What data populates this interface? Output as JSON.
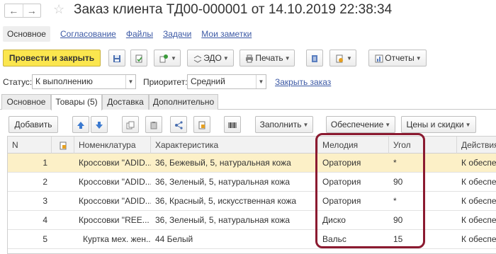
{
  "title": "Заказ клиента ТД00-000001 от 14.10.2019 22:38:34",
  "subnav": [
    "Основное",
    "Согласование",
    "Файлы",
    "Задачи",
    "Мои заметки"
  ],
  "toolbar": {
    "post_close": "Провести и закрыть",
    "edo": "ЭДО",
    "print": "Печать",
    "reports": "Отчеты"
  },
  "status": {
    "label": "Статус:",
    "value": "К выполнению",
    "priority_label": "Приоритет:",
    "priority_value": "Средний",
    "close_link": "Закрыть заказ"
  },
  "tabs": [
    "Основное",
    "Товары (5)",
    "Доставка",
    "Дополнительно"
  ],
  "table_toolbar": {
    "add": "Добавить",
    "fill": "Заполнить",
    "provision": "Обеспечение",
    "prices": "Цены и скидки"
  },
  "table": {
    "headers": [
      "N",
      "Номенклатура",
      "Характеристика",
      "Мелодия",
      "Угол",
      "Действия"
    ],
    "rows": [
      {
        "n": "1",
        "nom": "Кроссовки \"ADID...",
        "char": "36, Бежевый, 5, натуральная кожа",
        "melody": "Оратория",
        "angle": "*",
        "action": "К обеспеч"
      },
      {
        "n": "2",
        "nom": "Кроссовки \"ADID...",
        "char": "36, Зеленый, 5, натуральная кожа",
        "melody": "Оратория",
        "angle": "90",
        "action": "К обеспеч"
      },
      {
        "n": "3",
        "nom": "Кроссовки \"ADID...",
        "char": "36, Красный, 5, искусственная кожа",
        "melody": "Оратория",
        "angle": "*",
        "action": "К обеспеч"
      },
      {
        "n": "4",
        "nom": "Кроссовки \"REE...",
        "char": "36, Зеленый, 5, натуральная кожа",
        "melody": "Диско",
        "angle": "90",
        "action": "К обеспеч"
      },
      {
        "n": "5",
        "nom": "Куртка мех. жен...",
        "char": "44 Белый",
        "melody": "Вальс",
        "angle": "15",
        "action": "К обеспеч"
      }
    ]
  },
  "colors": {
    "accent": "#fbe64e",
    "selected_row": "#fcf0c7",
    "highlight": "#8b1a30",
    "link": "#3c59a5"
  }
}
